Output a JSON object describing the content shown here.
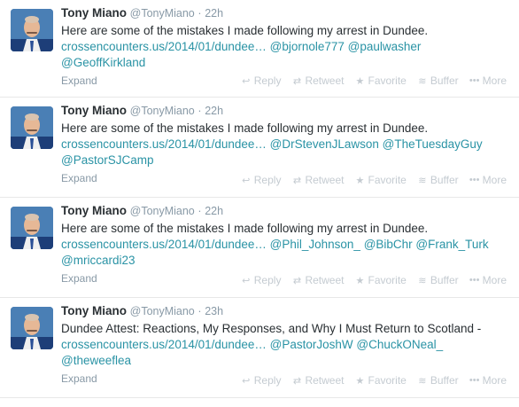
{
  "tweets": [
    {
      "name": "Tony Miano",
      "handle": "@TonyMiano",
      "time": "22h",
      "text": "Here are some of the mistakes I made following my arrest in Dundee.",
      "link": "crossencounters.us/2014/01/dundee…",
      "mentions1": "@bjornole777 @paulwasher",
      "mentions2": "@GeoffKirkland",
      "expand": "Expand"
    },
    {
      "name": "Tony Miano",
      "handle": "@TonyMiano",
      "time": "22h",
      "text": "Here are some of the mistakes I made following my arrest in Dundee.",
      "link": "crossencounters.us/2014/01/dundee…",
      "mentions1": "@DrStevenJLawson @TheTuesdayGuy",
      "mentions2": "@PastorSJCamp",
      "expand": "Expand"
    },
    {
      "name": "Tony Miano",
      "handle": "@TonyMiano",
      "time": "22h",
      "text": "Here are some of the mistakes I made following my arrest in Dundee.",
      "link": "crossencounters.us/2014/01/dundee…",
      "mentions1": "@Phil_Johnson_ @BibChr @Frank_Turk",
      "mentions2": "@mriccardi23",
      "expand": "Expand"
    },
    {
      "name": "Tony Miano",
      "handle": "@TonyMiano",
      "time": "23h",
      "text": "Dundee Attest: Reactions, My Responses, and Why I Must Return to Scotland -",
      "link": "crossencounters.us/2014/01/dundee…",
      "mentions1": "@PastorJoshW @ChuckONeal_",
      "mentions2": "@theweeflea",
      "expand": "Expand"
    }
  ],
  "actions": {
    "reply": "Reply",
    "retweet": "Retweet",
    "favorite": "Favorite",
    "buffer": "Buffer",
    "more": "More"
  },
  "separator": "·",
  "colors": {
    "link": "#2a93a5",
    "muted": "#8899a6",
    "action": "#c4cbd1",
    "text": "#292f33"
  }
}
